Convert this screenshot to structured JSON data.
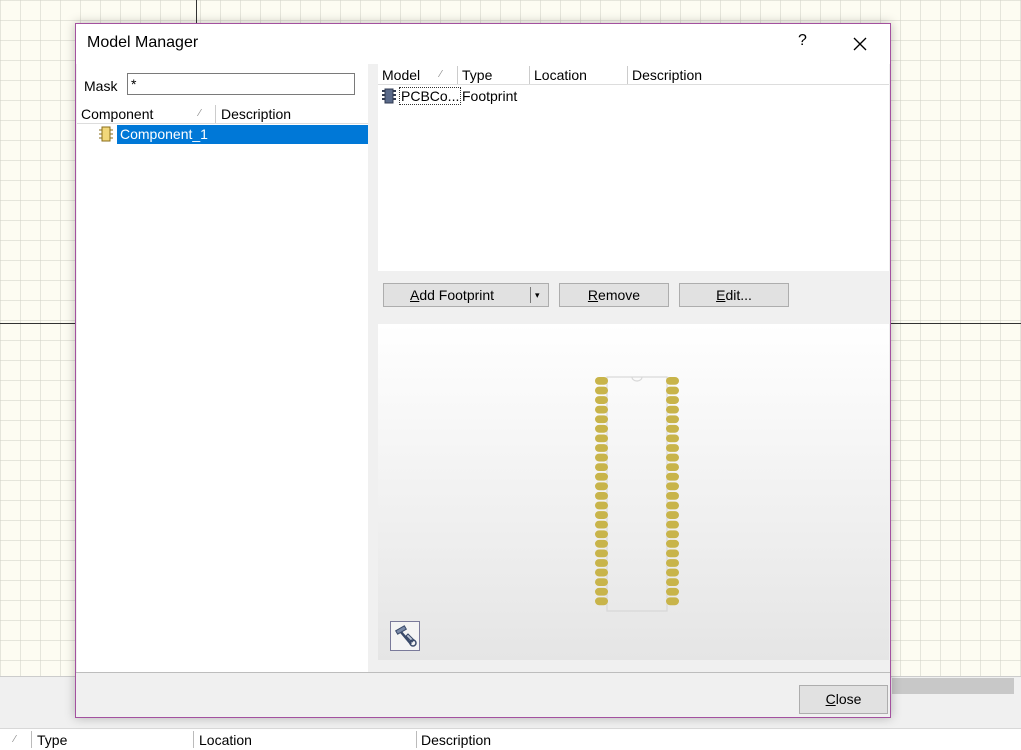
{
  "background": {
    "columns": [
      "Type",
      "Location",
      "Description"
    ],
    "sort_glyph": "⁄"
  },
  "dialog": {
    "title": "Model Manager",
    "help_label": "?",
    "close_icon": "close-icon",
    "mask": {
      "label": "Mask",
      "value": "*"
    },
    "component_list": {
      "columns": [
        "Component",
        "Description"
      ],
      "sort_glyph": "⁄",
      "items": [
        {
          "name": "Component_1",
          "selected": true,
          "icon": "component-icon"
        }
      ]
    },
    "model_list": {
      "columns": [
        "Model",
        "Type",
        "Location",
        "Description"
      ],
      "sort_glyph": "⁄",
      "rows": [
        {
          "model": "PCBCo...",
          "type": "Footprint",
          "location": "",
          "description": "",
          "icon": "footprint-icon"
        }
      ]
    },
    "buttons": {
      "add_footprint": {
        "mnemonic": "A",
        "rest": "dd Footprint",
        "dropdown_glyph": "▾"
      },
      "remove": {
        "mnemonic": "R",
        "rest": "emove"
      },
      "edit": {
        "mnemonic": "E",
        "rest": "dit..."
      },
      "close": {
        "mnemonic": "C",
        "rest": "lose"
      }
    },
    "preview": {
      "pad_color": "#c8b44a",
      "pins_per_side": 24,
      "tool_icon": "hammer-wrench-icon"
    },
    "colors": {
      "selection": "#0078d7",
      "border": "#a3519f"
    }
  }
}
